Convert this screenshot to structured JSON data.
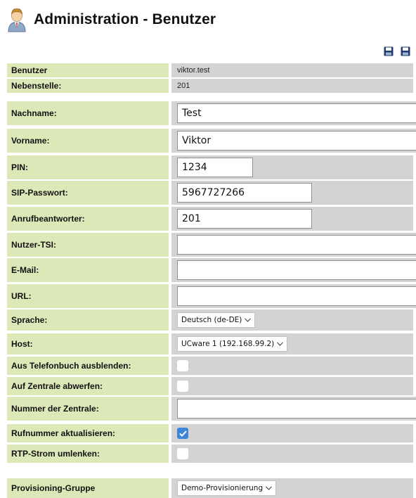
{
  "header": {
    "title": "Administration - Benutzer",
    "icon": "user-icon"
  },
  "toolbar": {
    "save_icon": "save-icon",
    "save_all_icon": "save-all-icon"
  },
  "fields": {
    "benutzer": {
      "label": "Benutzer",
      "value": "viktor.test"
    },
    "nebenstelle": {
      "label": "Nebenstelle:",
      "value": "201"
    },
    "nachname": {
      "label": "Nachname:",
      "value": ""
    },
    "vorname": {
      "label": "Vorname:",
      "value": ""
    },
    "pin": {
      "label": "PIN:",
      "value": ""
    },
    "sip_passwort": {
      "label": "SIP-Passwort:",
      "value": ""
    },
    "anrufbeantworter": {
      "label": "Anrufbeantworter:",
      "value": ""
    },
    "nutzer_tsi": {
      "label": "Nutzer-TSI:",
      "value": ""
    },
    "email": {
      "label": "E-Mail:",
      "value": ""
    },
    "url": {
      "label": "URL:",
      "value": ""
    },
    "sprache": {
      "label": "Sprache:",
      "selected": "Deutsch (de-DE)"
    },
    "host": {
      "label": "Host:",
      "selected": "UCware 1 (192.168.99.2)"
    },
    "aus_telefonbuch": {
      "label": "Aus Telefonbuch ausblenden:",
      "checked": false
    },
    "auf_zentrale": {
      "label": "Auf Zentrale abwerfen:",
      "checked": false
    },
    "nummer_zentrale": {
      "label": "Nummer der Zentrale:",
      "value": ""
    },
    "rufnummer_aktualisieren": {
      "label": "Rufnummer aktualisieren:",
      "checked": true
    },
    "rtp_strom": {
      "label": "RTP-Strom umlenken:",
      "checked": false
    },
    "provisioning_gruppe": {
      "label": "Provisioning-Gruppe",
      "selected": "Demo-Provisionierung"
    }
  },
  "inputs": {
    "nachname": "Test",
    "vorname": "Viktor",
    "pin": "1234",
    "sip_passwort": "5967727266",
    "anrufbeantworter": "201"
  },
  "colors": {
    "label_bg": "#dde8b8",
    "value_bg": "#d3d3d3",
    "checkbox_checked": "#3b86d8"
  }
}
